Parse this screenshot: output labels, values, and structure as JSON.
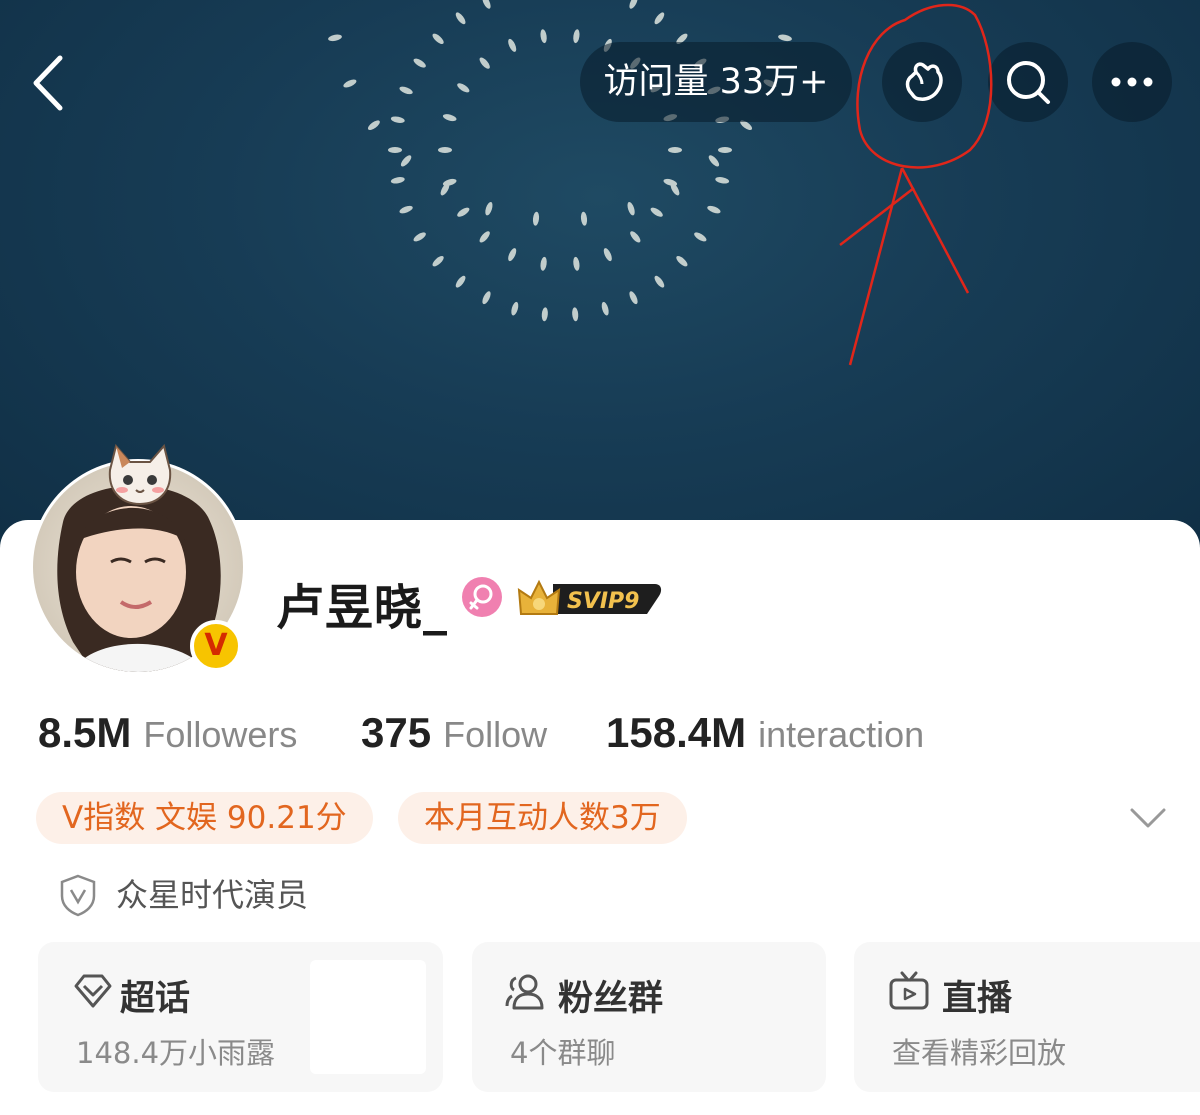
{
  "header": {
    "visits_label": "访问量 33万+"
  },
  "profile": {
    "username": "卢昱晓_",
    "badge_label": "SVIP9",
    "verified_letter": "V"
  },
  "stats": [
    {
      "value": "8.5M",
      "label": "Followers"
    },
    {
      "value": "375",
      "label": "Follow"
    },
    {
      "value": "158.4M",
      "label": "interaction"
    }
  ],
  "tags": [
    {
      "label": "V指数 文娱 90.21分"
    },
    {
      "label": "本月互动人数3万"
    }
  ],
  "verification": {
    "text": "众星时代演员"
  },
  "tiles": [
    {
      "title": "超话",
      "subtitle": "148.4万小雨露",
      "icon": "super-topic-icon"
    },
    {
      "title": "粉丝群",
      "subtitle": "4个群聊",
      "icon": "group-icon"
    },
    {
      "title": "直播",
      "subtitle": "查看精彩回放",
      "icon": "tv-icon"
    }
  ],
  "colors": {
    "cover_bg": "#173c55",
    "accent_orange": "#e2661f",
    "tag_bg": "#fdf0e8",
    "annotation_red": "#e0261a"
  }
}
